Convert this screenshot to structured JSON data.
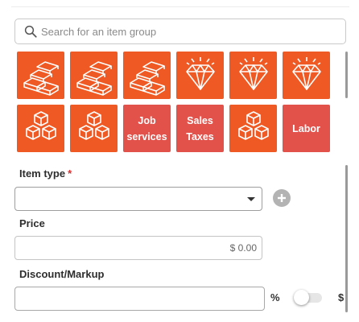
{
  "search": {
    "placeholder": "Search for an item group",
    "value": ""
  },
  "tiles": [
    {
      "kind": "icon",
      "icon": "gold-bars-icon",
      "color": "#ef5a24"
    },
    {
      "kind": "icon",
      "icon": "gold-bars-icon",
      "color": "#ef5a24"
    },
    {
      "kind": "icon",
      "icon": "gold-bars-icon",
      "color": "#ef5a24"
    },
    {
      "kind": "icon",
      "icon": "diamond-icon",
      "color": "#ef5a24"
    },
    {
      "kind": "icon",
      "icon": "diamond-icon",
      "color": "#ef5a24"
    },
    {
      "kind": "icon",
      "icon": "diamond-icon",
      "color": "#ef5a24"
    },
    {
      "kind": "icon",
      "icon": "boxes-icon",
      "color": "#ef5a24"
    },
    {
      "kind": "icon",
      "icon": "boxes-icon",
      "color": "#ef5a24"
    },
    {
      "kind": "text",
      "label": "Job\nservices",
      "color": "#e2514a"
    },
    {
      "kind": "text",
      "label": "Sales\nTaxes",
      "color": "#e2514a"
    },
    {
      "kind": "icon",
      "icon": "boxes-icon",
      "color": "#ef5a24"
    },
    {
      "kind": "text",
      "label": "Labor",
      "color": "#e2514a"
    }
  ],
  "item_type": {
    "label": "Item type",
    "required_marker": "*",
    "value": ""
  },
  "price": {
    "label": "Price",
    "value": "$ 0.00"
  },
  "discount": {
    "label": "Discount/Markup",
    "value": "",
    "percent_symbol": "%",
    "dollar_symbol": "$",
    "toggle_state": "percent"
  },
  "colors": {
    "tile_orange": "#ef5a24",
    "tile_red": "#e2514a",
    "required": "#d32f2f"
  }
}
